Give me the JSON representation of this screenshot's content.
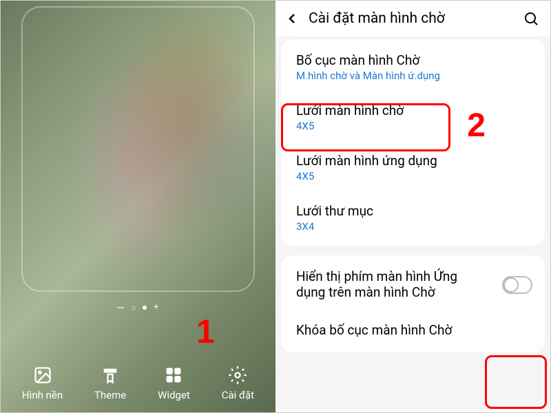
{
  "left": {
    "bottom_items": [
      {
        "label": "Hình nền",
        "icon": "wallpaper"
      },
      {
        "label": "Theme",
        "icon": "theme"
      },
      {
        "label": "Widget",
        "icon": "widget"
      },
      {
        "label": "Cài đặt",
        "icon": "gear"
      }
    ]
  },
  "right": {
    "header_title": "Cài đặt màn hình chờ",
    "group1": [
      {
        "title": "Bố cục màn hình Chờ",
        "value": "M.hình chờ và Màn hình ứ.dụng"
      },
      {
        "title": "Lưới màn hình chờ",
        "value": "4X5"
      },
      {
        "title": "Lưới màn hình ứng dụng",
        "value": "4X5"
      },
      {
        "title": "Lưới thư mục",
        "value": "3X4"
      }
    ],
    "group2": [
      {
        "title": "Hiển thị phím màn hình Ứng dụng trên màn hình Chờ"
      },
      {
        "title": "Khóa bố cục màn hình Chờ"
      }
    ]
  },
  "annotations": {
    "one": "1",
    "two": "2"
  }
}
